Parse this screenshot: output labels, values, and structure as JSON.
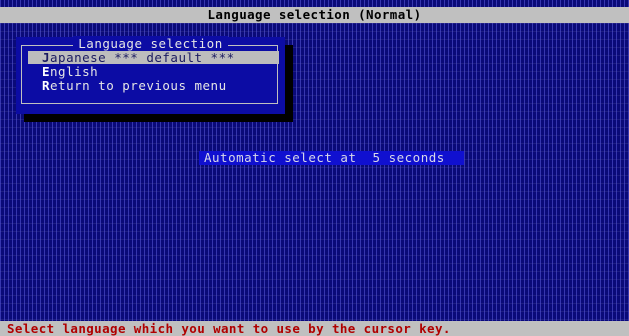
{
  "title_bar": {
    "text": "Language selection (Normal)"
  },
  "menu": {
    "heading": "Language selection",
    "items": [
      {
        "hotkey": "J",
        "rest": "apanese *** default ***",
        "selected": true
      },
      {
        "hotkey": "E",
        "rest": "nglish",
        "selected": false
      },
      {
        "hotkey": "R",
        "rest": "eturn to previous menu",
        "selected": false
      }
    ]
  },
  "countdown": {
    "text": "Automatic select at  5 seconds"
  },
  "status_bar": {
    "text": "Select language which you want to use by the cursor key."
  },
  "colors": {
    "screen_background": "#0a0a78",
    "menu_background": "#0c0ca4",
    "bar_gray": "#c0c0c0",
    "highlight": "#bdbdbd",
    "status_text": "#b00000",
    "countdown_background": "#1010d0"
  }
}
